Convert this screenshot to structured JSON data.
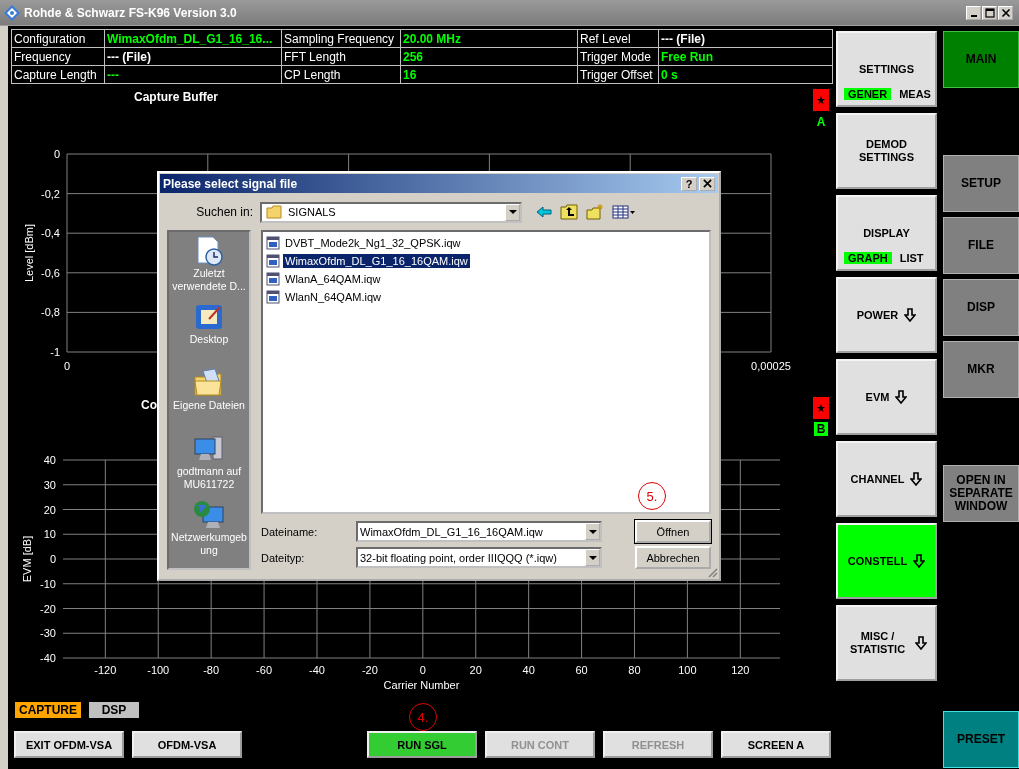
{
  "window": {
    "title": "Rohde & Schwarz FS-K96 Version 3.0"
  },
  "info_table": [
    [
      {
        "label": "Configuration",
        "value": "WimaxOfdm_DL_G1_16_16...",
        "color": "#00ff00"
      },
      {
        "label": "Sampling Frequency",
        "value": "20.00 MHz",
        "color": "#00ff00"
      },
      {
        "label": "Ref Level",
        "value": "--- **(File)**",
        "color": "#ffffff"
      }
    ],
    [
      {
        "label": "Frequency",
        "value": "--- **(File)**",
        "color": "#ffffff"
      },
      {
        "label": "FFT Length",
        "value": "256",
        "color": "#00ff00"
      },
      {
        "label": "Trigger Mode",
        "value": "Free Run",
        "color": "#00ff00"
      }
    ],
    [
      {
        "label": "Capture Length",
        "value": "---",
        "color": "#00ff00"
      },
      {
        "label": "CP Length",
        "value": "16",
        "color": "#00ff00"
      },
      {
        "label": "Trigger Offset",
        "value": "0 s",
        "color": "#00ff00"
      }
    ]
  ],
  "charts": [
    {
      "chart_data": {
        "type": "line",
        "grid": true,
        "title": "Capture Buffer",
        "ylabel": "Level [dBm]",
        "xlim": [
          0,
          0.00025
        ],
        "ylim": [
          -1,
          0
        ],
        "xticks": [
          0,
          {
            "value": 0.00025,
            "label": "0,00025"
          }
        ],
        "yticks": [
          0,
          {
            "value": -0.2,
            "label": "-0,2"
          },
          {
            "value": -0.4,
            "label": "-0,4"
          },
          {
            "value": -0.6,
            "label": "-0,6"
          },
          {
            "value": -0.8,
            "label": "-0,8"
          },
          -1
        ]
      },
      "marker": {
        "symbol": "★",
        "letter": "A",
        "boxed": false
      }
    },
    {
      "chart_data": {
        "type": "line",
        "grid": true,
        "title": "Co",
        "xlabel": "Carrier Number",
        "ylabel": "EVM [dB]",
        "xlim": [
          -136,
          135
        ],
        "ylim": [
          -40,
          40
        ],
        "xticks": [
          -120,
          -100,
          -80,
          -60,
          -40,
          -20,
          0,
          20,
          40,
          60,
          80,
          100,
          120
        ],
        "yticks": [
          40,
          30,
          20,
          10,
          0,
          -10,
          -20,
          -30,
          -40
        ]
      },
      "marker": {
        "symbol": "★",
        "letter": "B",
        "boxed": true
      }
    }
  ],
  "status_tags": [
    {
      "label": "CAPTURE",
      "on": true
    },
    {
      "label": "DSP",
      "on": false
    }
  ],
  "left_buttons": [
    {
      "label": "EXIT OFDM-VSA",
      "selected": false,
      "disabled": false
    },
    {
      "label": "OFDM-VSA",
      "selected": false,
      "disabled": false
    }
  ],
  "run_buttons": [
    {
      "label": "RUN SGL",
      "selected": true,
      "disabled": false,
      "annotation": "4."
    },
    {
      "label": "RUN CONT",
      "selected": false,
      "disabled": true
    },
    {
      "label": "REFRESH",
      "selected": false,
      "disabled": true
    },
    {
      "label": "SCREEN A",
      "selected": false,
      "disabled": false
    }
  ],
  "softkeys": [
    {
      "label": "SETTINGS",
      "selected": false,
      "submenu": false,
      "toggle": [
        {
          "label": "GENER",
          "selected": true
        },
        {
          "label": "MEAS",
          "selected": false
        }
      ]
    },
    {
      "label": "DEMOD SETTINGS",
      "selected": false,
      "submenu": false
    },
    {
      "label": "DISPLAY",
      "selected": false,
      "submenu": false,
      "toggle": [
        {
          "label": "GRAPH",
          "selected": true
        },
        {
          "label": "LIST",
          "selected": false
        }
      ]
    },
    {
      "label": "POWER",
      "selected": false,
      "submenu": true
    },
    {
      "label": "EVM",
      "selected": false,
      "submenu": true
    },
    {
      "label": "CHANNEL",
      "selected": false,
      "submenu": true
    },
    {
      "label": "CONSTELL",
      "selected": true,
      "submenu": true
    },
    {
      "label": "MISC / STATISTIC",
      "selected": false,
      "submenu": true
    }
  ],
  "hotkey_groups": [
    [
      {
        "label": "MAIN",
        "kind": "menu",
        "selected": true
      }
    ],
    [
      {
        "label": "SETUP",
        "kind": "menu",
        "selected": false
      },
      {
        "label": "FILE",
        "kind": "menu",
        "selected": false
      },
      {
        "label": "DISP",
        "kind": "menu",
        "selected": false
      },
      {
        "label": "MKR",
        "kind": "menu",
        "selected": false
      }
    ],
    [
      {
        "label": "OPEN IN SEPARATE WINDOW",
        "kind": "menu",
        "selected": false
      }
    ],
    [
      {
        "label": "PRESET",
        "kind": "preset",
        "selected": false
      }
    ]
  ],
  "dialog": {
    "title": "Please select signal file",
    "help": "?",
    "look_in_label": "Suchen in:",
    "look_in": "SIGNALS",
    "places": [
      {
        "label": "Zuletzt verwendete D...",
        "kind": "recent"
      },
      {
        "label": "Desktop",
        "kind": "desktop"
      },
      {
        "label": "Eigene Dateien",
        "kind": "documents"
      },
      {
        "label": "godtmann auf MU611722",
        "kind": "computer"
      },
      {
        "label": "Netzwerkumgebung",
        "kind": "network"
      }
    ],
    "files": [
      {
        "name": "DVBT_Mode2k_Ng1_32_QPSK.iqw",
        "selected": false
      },
      {
        "name": "WimaxOfdm_DL_G1_16_16QAM.iqw",
        "selected": true
      },
      {
        "name": "WlanA_64QAM.iqw",
        "selected": false
      },
      {
        "name": "WlanN_64QAM.iqw",
        "selected": false
      }
    ],
    "annotation": "5.",
    "filename_label": "Dateiname:",
    "filename": "WimaxOfdm_DL_G1_16_16QAM.iqw",
    "filetype_label": "Dateityp:",
    "filetype": "32-bit floating point, order IIIQQQ (*.iqw)",
    "buttons": [
      "Öffnen",
      "Abbrechen"
    ]
  }
}
